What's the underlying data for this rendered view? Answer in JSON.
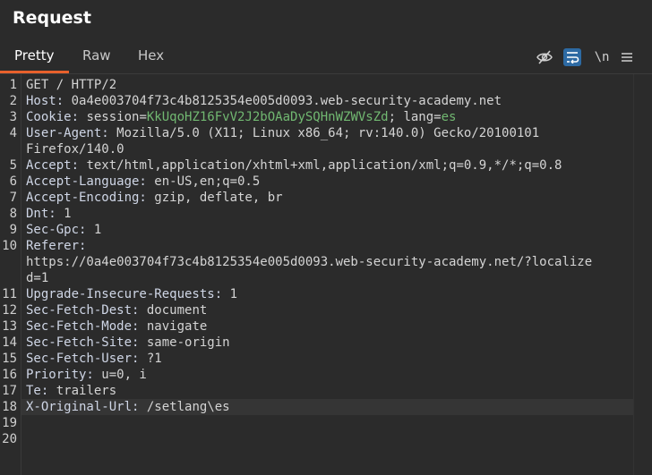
{
  "panel": {
    "title": "Request"
  },
  "tabs": [
    {
      "label": "Pretty"
    },
    {
      "label": "Raw"
    },
    {
      "label": "Hex"
    }
  ],
  "toolbar": {
    "newline_label": "\\n"
  },
  "lines": [
    {
      "n": "1",
      "parts": [
        {
          "t": "GET / HTTP/2"
        }
      ]
    },
    {
      "n": "2",
      "parts": [
        {
          "t": "Host:",
          "c": "k"
        },
        {
          "t": " 0a4e003704f73c4b8125354e005d0093.web-security-academy.net"
        }
      ]
    },
    {
      "n": "3",
      "parts": [
        {
          "t": "Cookie:",
          "c": "k"
        },
        {
          "t": " session="
        },
        {
          "t": "KkUqoHZ16FvV2J2bOAaDySQHnWZWVsZd",
          "c": "g"
        },
        {
          "t": "; lang="
        },
        {
          "t": "es",
          "c": "g"
        }
      ]
    },
    {
      "n": "4",
      "parts": [
        {
          "t": "User-Agent:",
          "c": "k"
        },
        {
          "t": " Mozilla/5.0 (X11; Linux x86_64; rv:140.0) Gecko/20100101"
        }
      ]
    },
    {
      "n": "",
      "parts": [
        {
          "t": "Firefox/140.0"
        }
      ]
    },
    {
      "n": "5",
      "parts": [
        {
          "t": "Accept:",
          "c": "k"
        },
        {
          "t": " text/html,application/xhtml+xml,application/xml;q=0.9,*/*;q=0.8"
        }
      ]
    },
    {
      "n": "6",
      "parts": [
        {
          "t": "Accept-Language:",
          "c": "k"
        },
        {
          "t": " en-US,en;q=0.5"
        }
      ]
    },
    {
      "n": "7",
      "parts": [
        {
          "t": "Accept-Encoding:",
          "c": "k"
        },
        {
          "t": " gzip, deflate, br"
        }
      ]
    },
    {
      "n": "8",
      "parts": [
        {
          "t": "Dnt:",
          "c": "k"
        },
        {
          "t": " 1"
        }
      ]
    },
    {
      "n": "9",
      "parts": [
        {
          "t": "Sec-Gpc:",
          "c": "k"
        },
        {
          "t": " 1"
        }
      ]
    },
    {
      "n": "10",
      "parts": [
        {
          "t": "Referer:",
          "c": "k"
        }
      ]
    },
    {
      "n": "",
      "parts": [
        {
          "t": "https://0a4e003704f73c4b8125354e005d0093.web-security-academy.net/?localize"
        }
      ]
    },
    {
      "n": "",
      "parts": [
        {
          "t": "d=1"
        }
      ]
    },
    {
      "n": "11",
      "parts": [
        {
          "t": "Upgrade-Insecure-Requests:",
          "c": "k"
        },
        {
          "t": " 1"
        }
      ]
    },
    {
      "n": "12",
      "parts": [
        {
          "t": "Sec-Fetch-Dest:",
          "c": "k"
        },
        {
          "t": " document"
        }
      ]
    },
    {
      "n": "13",
      "parts": [
        {
          "t": "Sec-Fetch-Mode:",
          "c": "k"
        },
        {
          "t": " navigate"
        }
      ]
    },
    {
      "n": "14",
      "parts": [
        {
          "t": "Sec-Fetch-Site:",
          "c": "k"
        },
        {
          "t": " same-origin"
        }
      ]
    },
    {
      "n": "15",
      "parts": [
        {
          "t": "Sec-Fetch-User:",
          "c": "k"
        },
        {
          "t": " ?1"
        }
      ]
    },
    {
      "n": "16",
      "parts": [
        {
          "t": "Priority:",
          "c": "k"
        },
        {
          "t": " u=0, i"
        }
      ]
    },
    {
      "n": "17",
      "parts": [
        {
          "t": "Te:",
          "c": "k"
        },
        {
          "t": " trailers"
        }
      ]
    },
    {
      "n": "18",
      "parts": [
        {
          "t": "X-Original-Url:",
          "c": "k"
        },
        {
          "t": " /setlang\\es"
        }
      ],
      "current": true
    },
    {
      "n": "19",
      "parts": []
    },
    {
      "n": "20",
      "parts": []
    }
  ],
  "colors": {
    "accent": "#e8612c",
    "header_key": "#cfd6e6",
    "value_green": "#71b871",
    "toggle_on": "#2d6aa3"
  },
  "icons": [
    "hide-non-printable-icon",
    "wrap-lines-icon",
    "menu-icon"
  ]
}
